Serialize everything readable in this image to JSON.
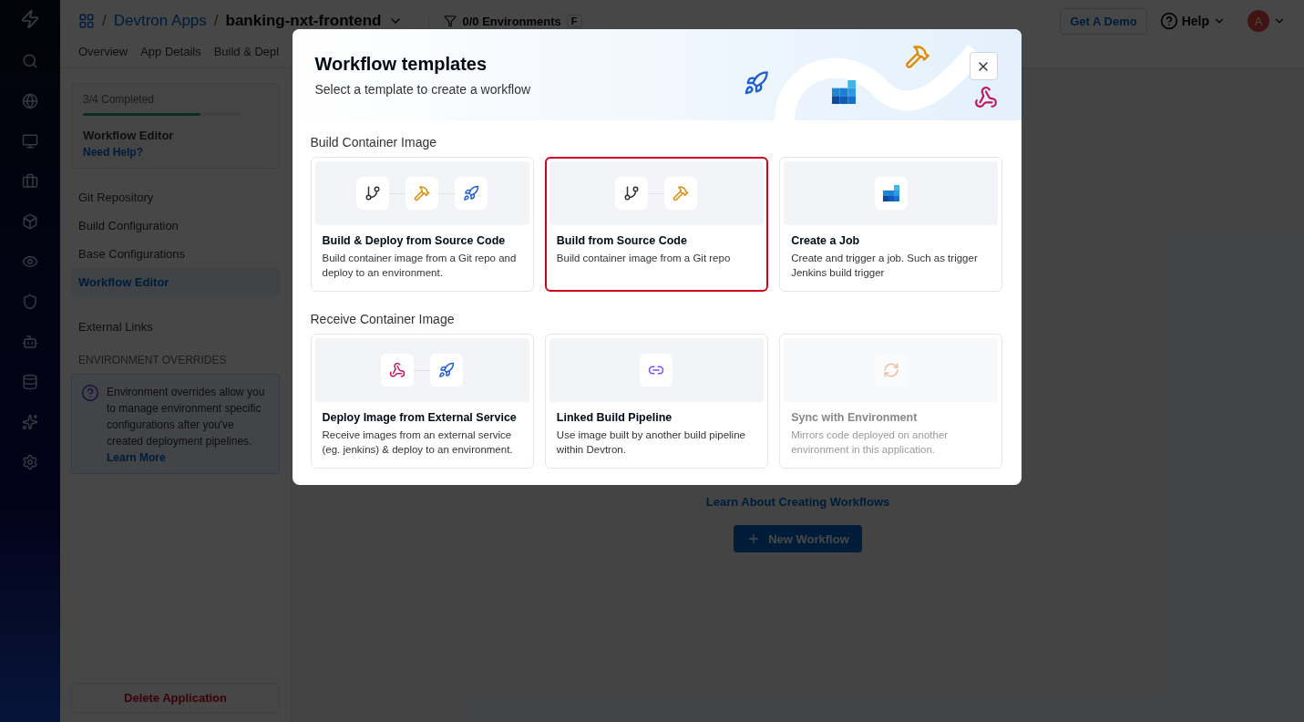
{
  "header": {
    "breadcrumb": {
      "separator": "/",
      "items": [
        {
          "text": "Devtron Apps",
          "kind": "link"
        },
        {
          "text": "banking-nxt-frontend",
          "kind": "current"
        }
      ]
    },
    "env_filter": {
      "label": "0/0 Environments",
      "key": "F"
    },
    "demo_button": "Get A Demo",
    "help": "Help",
    "avatar": "A"
  },
  "tabs": [
    "Overview",
    "App Details",
    "Build & Depl"
  ],
  "sidebar": {
    "progress": {
      "label": "3/4 Completed",
      "level": 0.75,
      "title": "Workflow Editor",
      "help_link": "Need Help?"
    },
    "items": [
      {
        "label": "Git Repository",
        "selected": false
      },
      {
        "label": "Build Configuration",
        "selected": false
      },
      {
        "label": "Base Configurations",
        "selected": false
      },
      {
        "label": "Workflow Editor",
        "selected": true
      }
    ],
    "external": "External Links",
    "section": "ENVIRONMENT OVERRIDES",
    "info": {
      "text": "Environment overrides allow you to manage environment specific configurations after you've created deployment pipelines.",
      "link": "Learn More"
    },
    "delete_button": "Delete Application"
  },
  "main": {
    "link": "Learn About Creating Workflows",
    "button": "New Workflow"
  },
  "modal": {
    "title": "Workflow templates",
    "subtitle": "Select a template to create a workflow",
    "sections": [
      {
        "label": "Build Container Image",
        "cards": [
          {
            "title": "Build & Deploy from Source Code",
            "description": "Build container image from a Git repo and deploy to an environment.",
            "icons": [
              {
                "kind": "git"
              },
              {
                "kind": "build"
              },
              {
                "kind": "deploy"
              }
            ],
            "selected": false,
            "disabled": false
          },
          {
            "title": "Build from Source Code",
            "description": "Build container image from a Git repo",
            "icons": [
              {
                "kind": "git"
              },
              {
                "kind": "build"
              }
            ],
            "selected": true,
            "disabled": false
          },
          {
            "title": "Create a Job",
            "description": "Create and trigger a job. Such as trigger Jenkins build trigger",
            "icons": [
              {
                "kind": "job"
              }
            ],
            "selected": false,
            "disabled": false
          }
        ]
      },
      {
        "label": "Receive Container Image",
        "cards": [
          {
            "title": "Deploy Image from External Service",
            "description": "Receive images from an external service (eg. jenkins) & deploy to an environment.",
            "icons": [
              {
                "kind": "webhook"
              },
              {
                "kind": "deploy"
              }
            ],
            "selected": false,
            "disabled": false
          },
          {
            "title": "Linked Build Pipeline",
            "description": "Use image built by another build pipeline within Devtron.",
            "icons": [
              {
                "kind": "linked"
              }
            ],
            "selected": false,
            "disabled": false
          },
          {
            "title": "Sync with Environment",
            "description": "Mirrors code deployed on another environment in this application.",
            "icons": [
              {
                "kind": "sync"
              }
            ],
            "selected": false,
            "disabled": true
          }
        ]
      }
    ]
  }
}
